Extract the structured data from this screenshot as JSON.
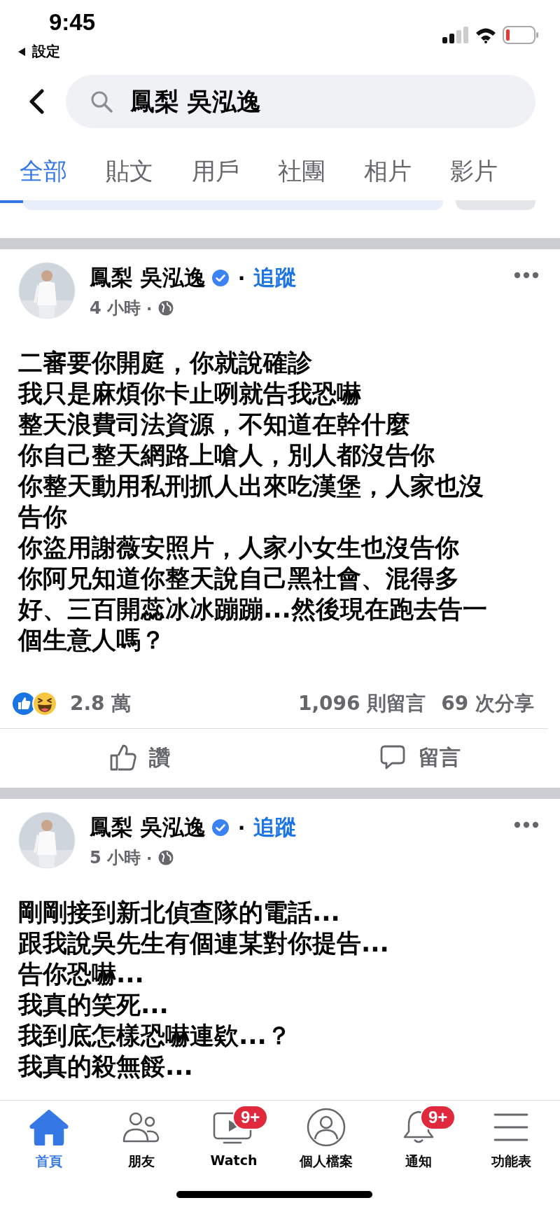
{
  "status_bar": {
    "time": "9:45",
    "back_label": "設定"
  },
  "search": {
    "value": "鳳梨 吳泓逸"
  },
  "tabs": [
    {
      "label": "全部",
      "selected": true
    },
    {
      "label": "貼文",
      "selected": false
    },
    {
      "label": "用戶",
      "selected": false
    },
    {
      "label": "社團",
      "selected": false
    },
    {
      "label": "相片",
      "selected": false
    },
    {
      "label": "影片",
      "selected": false
    }
  ],
  "posts": [
    {
      "author": "鳳梨 吳泓逸",
      "verified": true,
      "separator": "·",
      "follow": "追蹤",
      "time": "4 小時",
      "time_separator": "·",
      "lines": [
        "二審要你開庭，你就說確診",
        "我只是麻煩你卡止咧就告我恐嚇",
        "整天浪費司法資源，不知道在幹什麼",
        "你自己整天網路上嗆人，別人都沒告你",
        "你整天動用私刑抓人出來吃漢堡，人家也沒",
        "告你",
        "你盜用謝薇安照片，人家小女生也沒告你",
        "你阿兄知道你整天說自己黑社會、混得多",
        "好、三百開蕊冰冰蹦蹦...然後現在跑去告一",
        "個生意人嗎？"
      ],
      "reactions": "2.8 萬",
      "comments": "1,096 則留言",
      "shares": "69 次分享",
      "actions": [
        {
          "kind": "like",
          "label": "讚"
        },
        {
          "kind": "comment",
          "label": "留言"
        }
      ]
    },
    {
      "author": "鳳梨 吳泓逸",
      "verified": true,
      "separator": "·",
      "follow": "追蹤",
      "time": "5 小時",
      "time_separator": "·",
      "lines": [
        "剛剛接到新北偵查隊的電話...",
        "跟我說吳先生有個連某對你提告...",
        "告你恐嚇...",
        "我真的笑死...",
        "我到底怎樣恐嚇連欵...？",
        "我真的殺無餒..."
      ]
    }
  ],
  "nav": [
    {
      "kind": "home",
      "label": "首頁",
      "selected": true
    },
    {
      "kind": "friends",
      "label": "朋友",
      "selected": false
    },
    {
      "kind": "watch",
      "label": "Watch",
      "selected": false,
      "badge": "9+"
    },
    {
      "kind": "profile",
      "label": "個人檔案",
      "selected": false
    },
    {
      "kind": "bell",
      "label": "通知",
      "selected": false,
      "badge": "9+"
    },
    {
      "kind": "menu",
      "label": "功能表",
      "selected": false
    }
  ]
}
